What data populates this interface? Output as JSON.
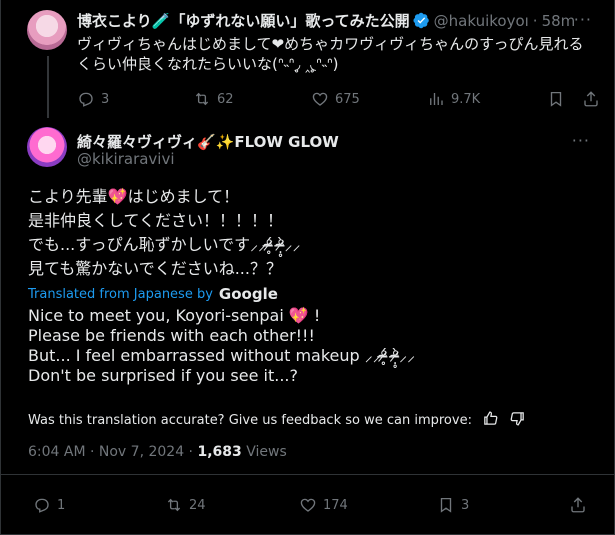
{
  "parent": {
    "name": "博衣こより🧪「ゆずれない願い」歌ってみた公開",
    "handle": "@hakuikoyoı",
    "dot": "·",
    "time": "58m",
    "more": "···",
    "text": "ヴィヴィちゃんはじめまして❤めちゃカワヴィヴィちゃんのすっぴん見れるくらい仲良くなれたらいいな(ᐢ˵ᐢ◞̥ ‸◟̥ᐢ˵ᐢ)",
    "stats": {
      "replies": "3",
      "reposts": "62",
      "likes": "675",
      "views": "9.7K"
    }
  },
  "tweet": {
    "name": "綺々羅々ヴィヴィ🎸✨FLOW GLOW",
    "handle": "@kikiraravivi",
    "jp_lines": [
      "こより先輩💖はじめまして！",
      "是非仲良くしてください！！！！！",
      "でも...すっぴん恥ずかしいです⸝⸝ᵒ̴̶̷̥́ ᵒ̴̶̷̣̥̀⸝⸝",
      "見ても驚かないでくださいね...？？"
    ],
    "translated_label": "Translated from Japanese by",
    "translator": "Google",
    "en_lines": [
      "Nice to meet you, Koyori-senpai 💖 !",
      "Please be friends with each other!!!",
      "But... I feel embarrassed without makeup ⸝⸝ᵒ̴̶̷̥́ ᵒ̴̶̷̣̥̀⸝⸝",
      "Don't be surprised if you see it...?"
    ],
    "feedback_text": "Was this translation accurate? Give us feedback so we can improve:",
    "time": "6:04 AM · Nov 7, 2024 · ",
    "views_count": "1,683",
    "views_label": " Views",
    "stats": {
      "replies": "1",
      "reposts": "24",
      "likes": "174",
      "bookmarks": "3"
    }
  },
  "colors": {
    "bg": "#000000",
    "text": "#e7e9ea",
    "muted": "#71767b",
    "accent": "#1d9bf0",
    "border": "#2f3336"
  }
}
